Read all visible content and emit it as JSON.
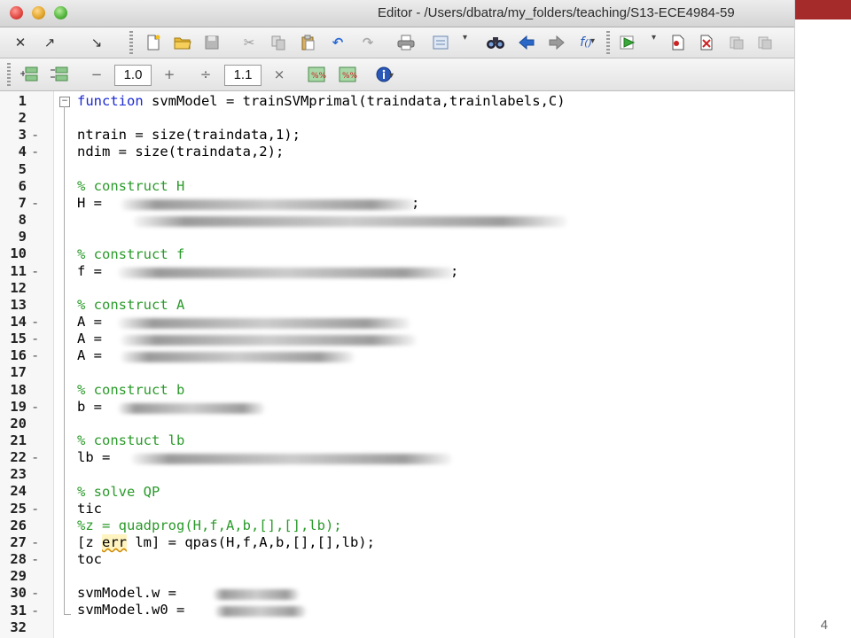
{
  "window": {
    "title": "Editor - /Users/dbatra/my_folders/teaching/S13-ECE4984-59"
  },
  "toolbar2": {
    "minus": "−",
    "value1": "1.0",
    "plus": "+",
    "divide": "÷",
    "value2": "1.1",
    "times": "×"
  },
  "code": {
    "func_keyword": "function",
    "func_rest": " svmModel = trainSVMprimal(traindata,trainlabels,C)",
    "ntrain": "ntrain = size(traindata,1);",
    "ndim": "ndim = size(traindata,2);",
    "c_H": "% construct H",
    "H": "H =",
    "H_semicolon": ";",
    "c_f": "% construct f",
    "f": "f =",
    "f_semicolon": ";",
    "c_A": "% construct A",
    "A1": "A =",
    "A2": "A =",
    "A3": "A =",
    "c_b": "% construct b",
    "b": "b =",
    "c_lb": "% constuct lb",
    "lb": "lb =",
    "c_QP": "% solve QP",
    "tic": "tic",
    "quadprog": "%z = quadprog(H,f,A,b,[],[],lb);",
    "qpas_pre": "[z ",
    "qpas_err": "err",
    "qpas_post": " lm] = qpas(H,f,A,b,[],[],lb);",
    "toc": "toc",
    "w": "svmModel.w =",
    "w0": "svmModel.w0 ="
  },
  "line_numbers": [
    "1",
    "2",
    "3",
    "4",
    "5",
    "6",
    "7",
    "8",
    "9",
    "10",
    "11",
    "12",
    "13",
    "14",
    "15",
    "16",
    "17",
    "18",
    "19",
    "20",
    "21",
    "22",
    "23",
    "24",
    "25",
    "26",
    "27",
    "28",
    "29",
    "30",
    "31",
    "32"
  ],
  "breakpoint_marks": [
    "",
    "",
    "-",
    "-",
    "",
    "",
    "-",
    "",
    "",
    "",
    "-",
    "",
    "",
    "-",
    "-",
    "-",
    "",
    "",
    "-",
    "",
    "",
    "-",
    "",
    "",
    "-",
    "",
    "-",
    "-",
    "",
    "-",
    "-",
    ""
  ],
  "slide": {
    "page_number": "4"
  }
}
